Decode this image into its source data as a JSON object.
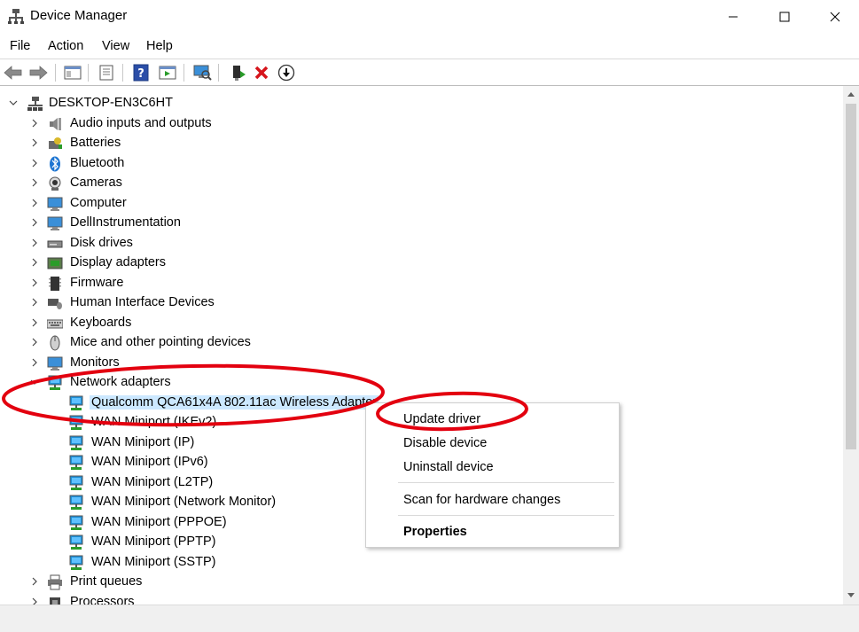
{
  "window": {
    "title": "Device Manager"
  },
  "menu": [
    "File",
    "Action",
    "View",
    "Help"
  ],
  "toolbar": {
    "icons": [
      "back-arrow-icon",
      "forward-arrow-icon",
      "show-hide-console-tree-icon",
      "properties-icon",
      "help-icon",
      "action-pane-icon",
      "scan-hardware-icon",
      "update-driver-icon",
      "uninstall-icon",
      "download-icon"
    ]
  },
  "tree": {
    "root": "DESKTOP-EN3C6HT",
    "categories": [
      "Audio inputs and outputs",
      "Batteries",
      "Bluetooth",
      "Cameras",
      "Computer",
      "DellInstrumentation",
      "Disk drives",
      "Display adapters",
      "Firmware",
      "Human Interface Devices",
      "Keyboards",
      "Mice and other pointing devices",
      "Monitors",
      "Network adapters"
    ],
    "network_adapters": [
      "Qualcomm QCA61x4A 802.11ac Wireless Adapter",
      "WAN Miniport (IKEv2)",
      "WAN Miniport (IP)",
      "WAN Miniport (IPv6)",
      "WAN Miniport (L2TP)",
      "WAN Miniport (Network Monitor)",
      "WAN Miniport (PPPOE)",
      "WAN Miniport (PPTP)",
      "WAN Miniport (SSTP)"
    ],
    "after": [
      "Print queues",
      "Processors"
    ]
  },
  "context_menu": {
    "update": "Update driver",
    "disable": "Disable device",
    "uninstall": "Uninstall device",
    "scan": "Scan for hardware changes",
    "properties": "Properties"
  },
  "colors": {
    "annotation": "#e3000f",
    "selection": "#cce8ff",
    "network_icon": "#1e8fd6"
  }
}
